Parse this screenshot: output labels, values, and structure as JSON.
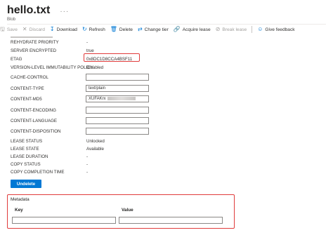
{
  "header": {
    "title": "hello.txt",
    "more": "···",
    "subtitle": "Blob"
  },
  "toolbar": {
    "save": "Save",
    "discard": "Discard",
    "download": "Download",
    "refresh": "Refresh",
    "delete": "Delete",
    "change_tier": "Change tier",
    "acquire_lease": "Acquire lease",
    "break_lease": "Break lease",
    "give_feedback": "Give feedback"
  },
  "properties": {
    "rehydrate_priority": {
      "label": "REHYDRATE PRIORITY",
      "value": "-"
    },
    "server_encrypted": {
      "label": "SERVER ENCRYPTED",
      "value": "true"
    },
    "etag": {
      "label": "ETAG",
      "value": "0x8DC1D8CCA4BSF11"
    },
    "immutability": {
      "label": "VERSION-LEVEL IMMUTABILITY POLICY",
      "value": "Disabled"
    },
    "cache_control": {
      "label": "CACHE-CONTROL",
      "value": ""
    },
    "content_type": {
      "label": "CONTENT-TYPE",
      "value": "text/plain"
    },
    "content_md5": {
      "label": "CONTENT-MD5",
      "value": "XUFAKrx"
    },
    "content_encoding": {
      "label": "CONTENT-ENCODING",
      "value": ""
    },
    "content_language": {
      "label": "CONTENT-LANGUAGE",
      "value": ""
    },
    "content_disposition": {
      "label": "CONTENT-DISPOSITION",
      "value": ""
    },
    "lease_status": {
      "label": "LEASE STATUS",
      "value": "Unlocked"
    },
    "lease_state": {
      "label": "LEASE STATE",
      "value": "Available"
    },
    "lease_duration": {
      "label": "LEASE DURATION",
      "value": "-"
    },
    "copy_status": {
      "label": "COPY STATUS",
      "value": "-"
    },
    "copy_completion_time": {
      "label": "COPY COMPLETION TIME",
      "value": "-"
    }
  },
  "undelete_button": "Undelete",
  "metadata": {
    "title": "Metadata",
    "key_header": "Key",
    "value_header": "Value",
    "key_value": "",
    "value_value": ""
  },
  "colors": {
    "accent": "#0078d4",
    "highlight": "#e03b3b"
  }
}
